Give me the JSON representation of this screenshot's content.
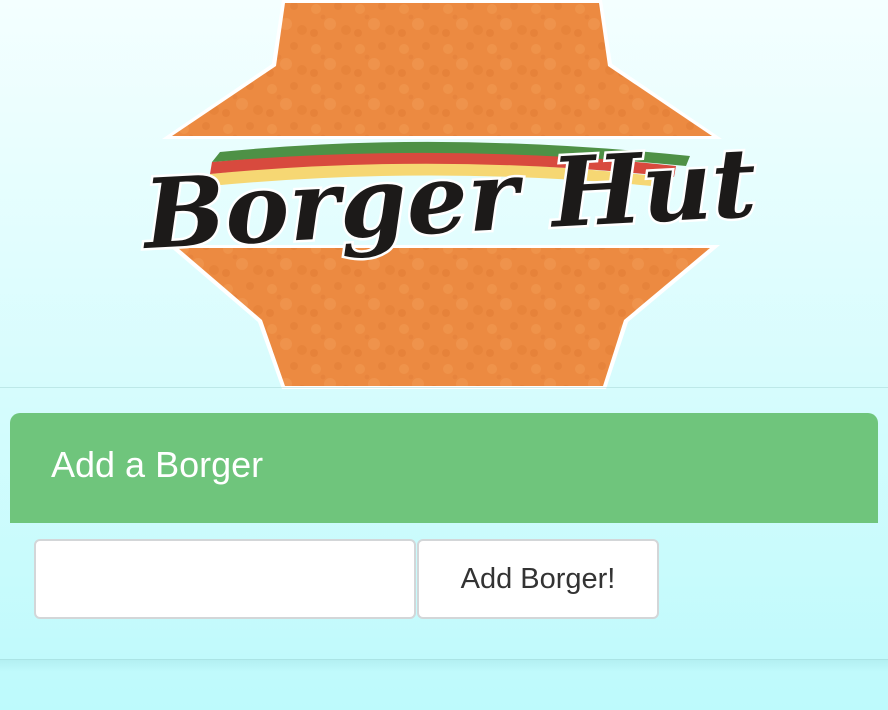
{
  "logo": {
    "brand_name": "Borger Hut",
    "colors": {
      "bun": "#ec8a41",
      "lettuce": "#4e9146",
      "tomato": "#d84a3e",
      "cheese": "#f6d773",
      "lettering": "#1c1a19"
    }
  },
  "form_panel": {
    "title": "Add a Borger",
    "input": {
      "value": "",
      "placeholder": ""
    },
    "submit_label": "Add Borger!",
    "heading_color": "#6fc57c"
  }
}
